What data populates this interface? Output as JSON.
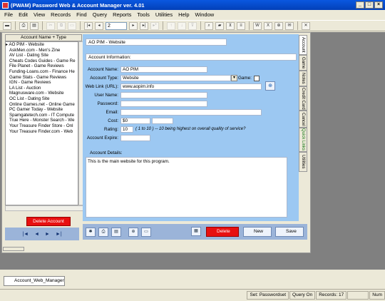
{
  "window": {
    "title": "(PWAM) Password Web & Account Manager ver. 4.01",
    "controls": [
      "_",
      "□",
      "×"
    ]
  },
  "menu": [
    "File",
    "Edit",
    "View",
    "Records",
    "Find",
    "Query",
    "Reports",
    "Tools",
    "Utilities",
    "Help",
    "Window"
  ],
  "toolbar": {
    "record_number": "2"
  },
  "list": {
    "header": "Account Name + Type",
    "items": [
      "AO PIM - Website",
      "AskMen.com - Men's Zine",
      "AV List - Dating Site",
      "Cheats Codes Guides - Game Re",
      "File Planet - Game Reviews",
      "Funding-Loans.com - Finance He",
      "Game Stats - Game Reviews",
      "IGN - Game Reviews",
      "LA List - Auction",
      "Magnusware.com - Website",
      "OC List - Dating Site",
      "Online Games.net - Online Game",
      "PC Gamer Today - Website",
      "Spamgatetech.com - IT Compute",
      "True Here - Monster Search - We",
      "Your Treasure Finder Store - Onl",
      "Your Treasure Finder.com - Web"
    ],
    "selected_index": 0,
    "selected_marker": "▸"
  },
  "delete_account_label": "Delete Account",
  "nav": [
    "|◄",
    "◄",
    "►",
    "►|"
  ],
  "detail": {
    "header_title": "AO PIM - Website",
    "section_info": "Account Information:",
    "labels": {
      "name": "Account Name:",
      "type": "Account Type:",
      "game": "Game:",
      "url": "Web Link (URL):",
      "user": "User Name:",
      "password": "Password:",
      "email": "Email:",
      "cost": "Cost:",
      "rating": "Rating:",
      "expire": "Account Expire:",
      "details": "Account Details:"
    },
    "values": {
      "name": "AO PIM",
      "type": "Website",
      "url": "www.aopim.info",
      "user": "",
      "password": "",
      "email": "",
      "cost": "$0",
      "rating": "10",
      "rating_hint": "( 1 to 10 ) -- 10 being highest on overall quality of service?",
      "expire": ""
    },
    "notes": "This is the main website for this program."
  },
  "tabs": [
    "Account",
    "Game",
    "Notes",
    "Credit Card",
    "Cancel",
    "Quick Links",
    "Utilities"
  ],
  "buttons": {
    "delete": "Delete",
    "new": "New",
    "save": "Save"
  },
  "taskbar": {
    "tab": "Account_Web_Manager"
  },
  "status": {
    "set": "Set: Passwordset",
    "query": "Query On",
    "records": "Records: 17",
    "num": "Num"
  }
}
